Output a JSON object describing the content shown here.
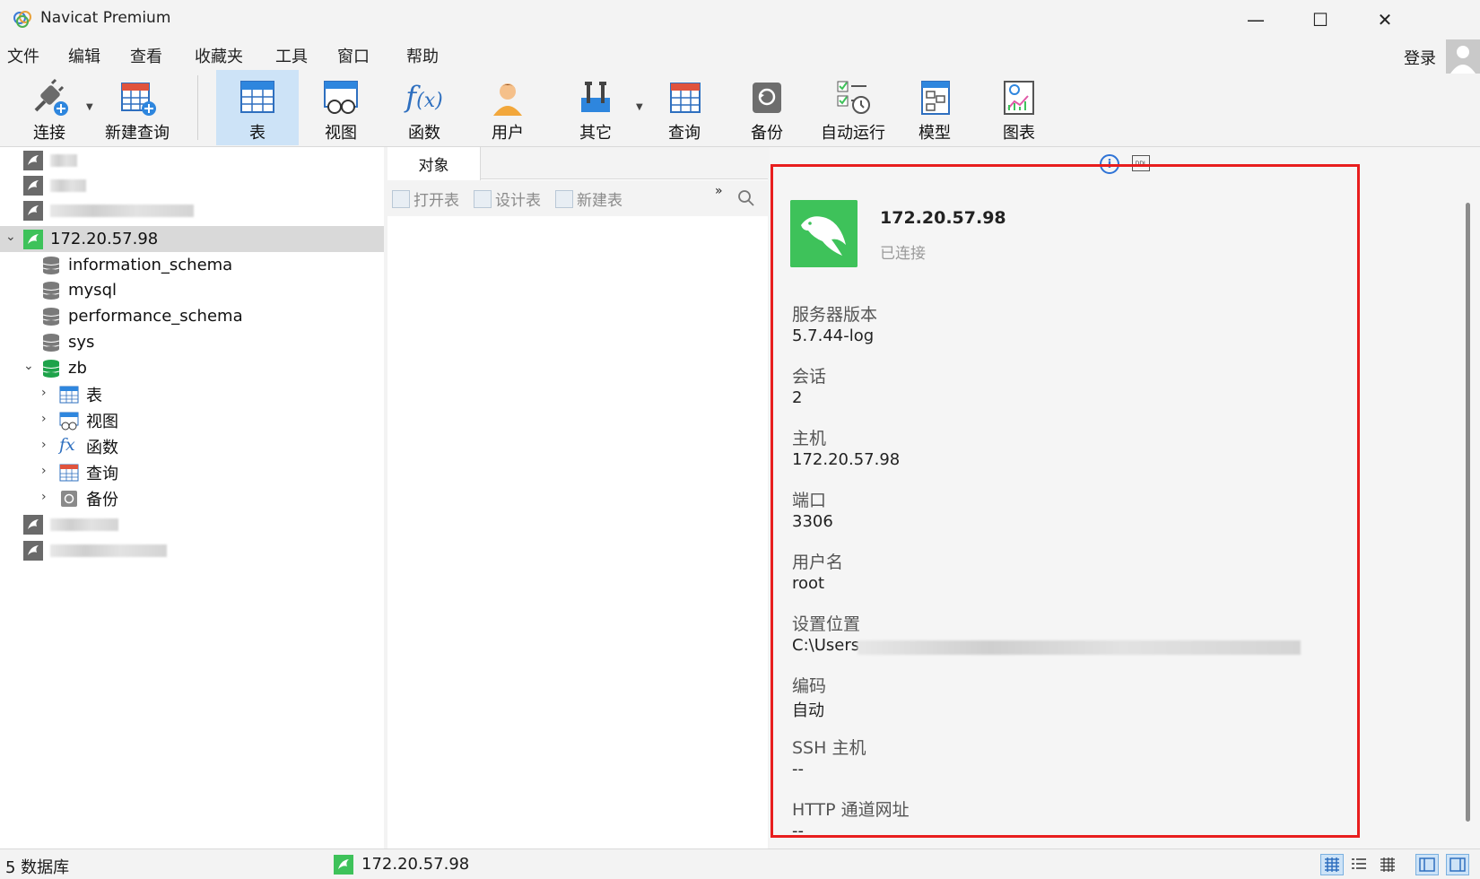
{
  "window": {
    "title": "Navicat Premium",
    "minimize": "—",
    "maximize": "☐",
    "close": "✕"
  },
  "menu": [
    "文件",
    "编辑",
    "查看",
    "收藏夹",
    "工具",
    "窗口",
    "帮助"
  ],
  "login": "登录",
  "toolbar": {
    "connect": "连接",
    "new_query": "新建查询",
    "table": "表",
    "view": "视图",
    "function": "函数",
    "user": "用户",
    "other": "其它",
    "query": "查询",
    "backup": "备份",
    "auto_run": "自动运行",
    "model": "模型",
    "chart": "图表"
  },
  "tree": {
    "connection": "172.20.57.98",
    "databases": [
      "information_schema",
      "mysql",
      "performance_schema",
      "sys",
      "zb"
    ],
    "zb_children": [
      "表",
      "视图",
      "函数",
      "查询",
      "备份"
    ]
  },
  "middle": {
    "tab": "对象",
    "open_table": "打开表",
    "design_table": "设计表",
    "new_table": "新建表",
    "more": "»"
  },
  "info": {
    "name": "172.20.57.98",
    "status": "已连接",
    "fields": [
      {
        "label": "服务器版本",
        "value": "5.7.44-log"
      },
      {
        "label": "会话",
        "value": "2"
      },
      {
        "label": "主机",
        "value": "172.20.57.98"
      },
      {
        "label": "端口",
        "value": "3306"
      },
      {
        "label": "用户名",
        "value": "root"
      },
      {
        "label": "设置位置",
        "value": "C:\\Users"
      },
      {
        "label": "编码",
        "value": "自动"
      },
      {
        "label": "SSH 主机",
        "value": "--"
      },
      {
        "label": "HTTP 通道网址",
        "value": "--"
      }
    ]
  },
  "statusbar": {
    "db_count": "5 数据库",
    "connection": "172.20.57.98"
  },
  "colors": {
    "accent_green": "#3ec25a",
    "highlight_red": "#e81e1e",
    "selected_blue": "#cde3f7"
  }
}
